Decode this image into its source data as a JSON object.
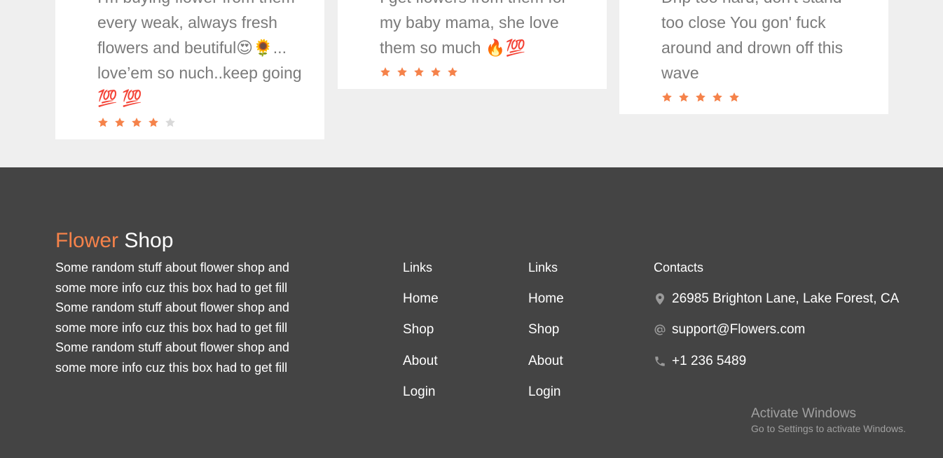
{
  "reviews": [
    {
      "text": "I'm buying flower from them\nevery weak, always fresh\nflowers and beutiful😍🌻...\nlove’em so nuch..keep going\n💯 💯",
      "rating": 4,
      "max_rating": 5
    },
    {
      "text": "I get flowers from them for\nmy baby mama, she love\nthem so much 🔥💯",
      "rating": 5,
      "max_rating": 5
    },
    {
      "text": "Drip too hard, don't stand\ntoo close You gon' fuck\naround and drown off this\nwave",
      "rating": 5,
      "max_rating": 5
    }
  ],
  "footer": {
    "brand_accent": "Flower",
    "brand_main": "Shop",
    "about": "Some random stuff about flower shop and some more info cuz this box had to get fill Some random stuff about flower shop and some more info cuz this box had to get fill Some random stuff about flower shop and some more info cuz this box had to get fill",
    "links1": {
      "heading": "Links",
      "items": [
        "Home",
        "Shop",
        "About",
        "Login"
      ]
    },
    "links2": {
      "heading": "Links",
      "items": [
        "Home",
        "Shop",
        "About",
        "Login"
      ]
    },
    "contacts": {
      "heading": "Contacts",
      "address": "26985 Brighton Lane, Lake Forest, CA",
      "email": "support@Flowers.com",
      "phone": "+1 236 5489"
    }
  },
  "watermark": {
    "line1": "Activate Windows",
    "line2": "Go to Settings to activate Windows."
  },
  "colors": {
    "accent": "#f5824a",
    "footer_bg": "#444444",
    "page_bg": "#efefef",
    "star_empty": "#d9d9d9"
  },
  "icons": [
    "star-icon",
    "location-pin-icon",
    "at-sign-icon",
    "phone-icon"
  ]
}
